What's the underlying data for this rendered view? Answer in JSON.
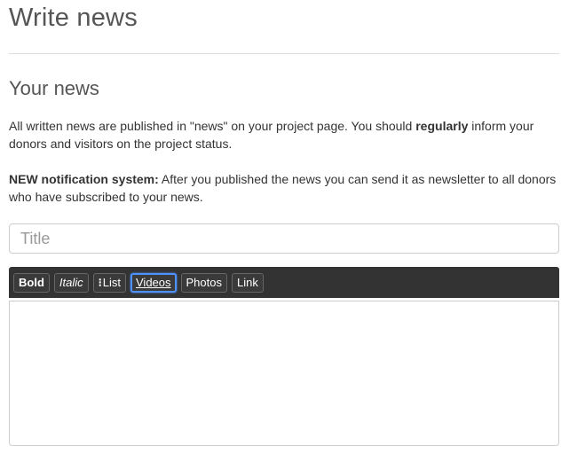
{
  "page": {
    "title": "Write news"
  },
  "section": {
    "title": "Your news",
    "intro_text": "All written news are published in \"news\" on your project page. You should ",
    "intro_bold": "regularly",
    "intro_tail": " inform your donors and visitors on the project status.",
    "notice_bold": "NEW notification system:",
    "notice_text": " After you published the news you can send it as newsletter to all donors who have subscribed to your news."
  },
  "form": {
    "title_placeholder": "Title",
    "title_value": "",
    "body_value": ""
  },
  "toolbar": {
    "bold_label": "Bold",
    "italic_label": "Italic",
    "list_glyph": "⁝",
    "list_label": "List",
    "videos_label": "Videos",
    "photos_label": "Photos",
    "link_label": "Link"
  },
  "colors": {
    "toolbar_bg": "#333333",
    "focus_ring": "#4d90fe",
    "heading": "#555555",
    "text": "#333333",
    "border": "#cccccc"
  }
}
